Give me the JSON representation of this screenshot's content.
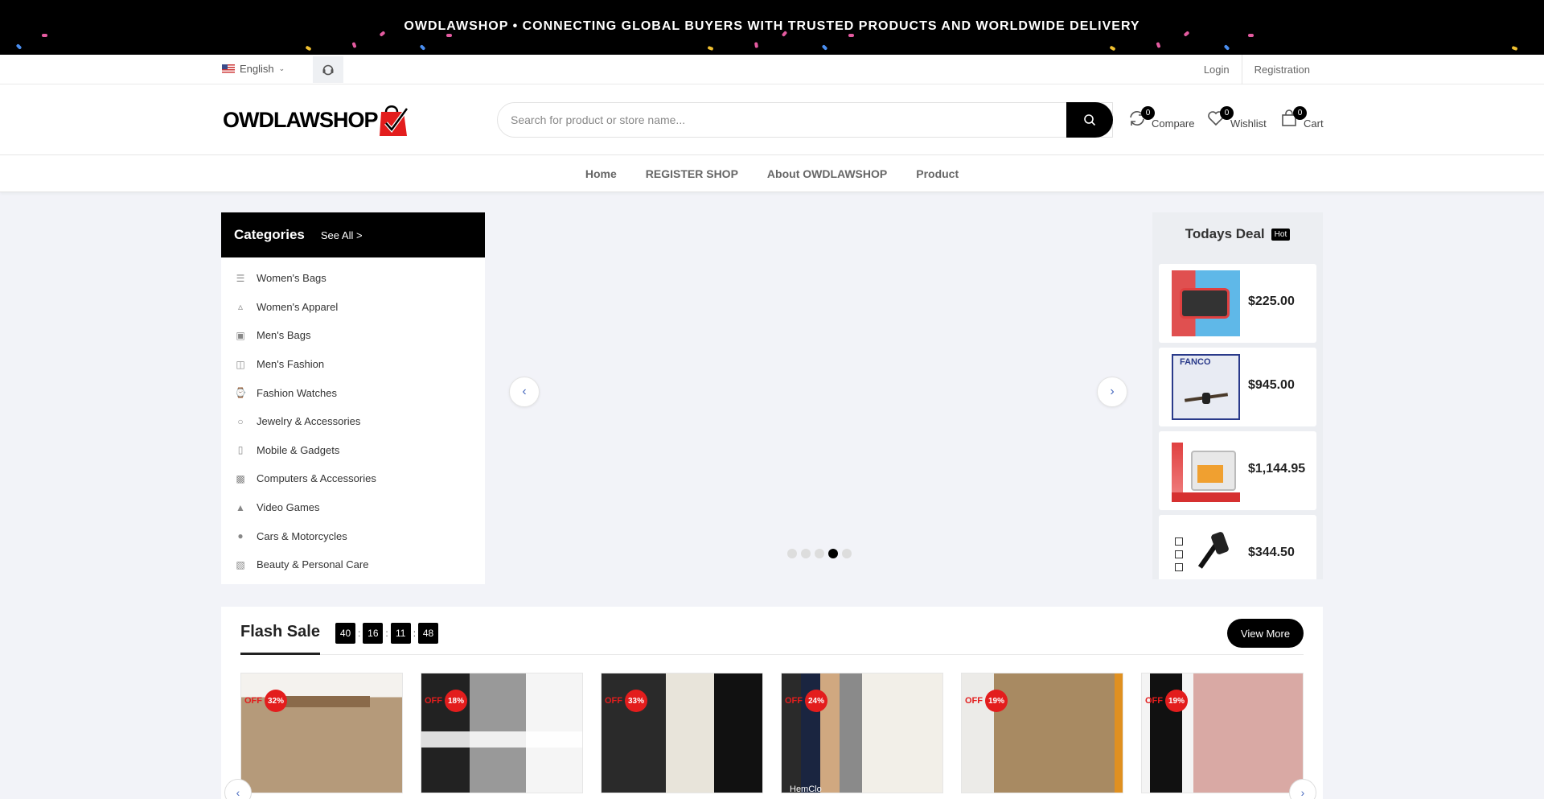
{
  "banner": {
    "text": "OWDLAWSHOP • CONNECTING GLOBAL BUYERS WITH TRUSTED PRODUCTS AND WORLDWIDE DELIVERY"
  },
  "topbar": {
    "language": "English",
    "login": "Login",
    "registration": "Registration"
  },
  "header": {
    "logo_text": "OWDLAWSHOP",
    "search_placeholder": "Search for product or store name...",
    "compare_label": "Compare",
    "compare_count": "0",
    "wishlist_label": "Wishlist",
    "wishlist_count": "0",
    "cart_label": "Cart",
    "cart_count": "0"
  },
  "nav": {
    "items": [
      "Home",
      "REGISTER SHOP",
      "About OWDLAWSHOP",
      "Product"
    ]
  },
  "categories": {
    "title": "Categories",
    "see_all": "See All >",
    "items": [
      "Women's Bags",
      "Women's Apparel",
      "Men's Bags",
      "Men's Fashion",
      "Fashion Watches",
      "Jewelry & Accessories",
      "Mobile & Gadgets",
      "Computers & Accessories",
      "Video Games",
      "Cars & Motorcycles",
      "Beauty & Personal Care"
    ]
  },
  "slider": {
    "active_dot": 4,
    "dot_count": 5
  },
  "todays_deal": {
    "title": "Todays Deal",
    "badge": "Hot",
    "items": [
      {
        "price": "$225.00"
      },
      {
        "price": "$945.00"
      },
      {
        "price": "$1,144.95"
      },
      {
        "price": "$344.50"
      }
    ]
  },
  "flash_sale": {
    "title": "Flash Sale",
    "timer": [
      "40",
      "16",
      "11",
      "48"
    ],
    "timer_sep": ":",
    "view_more": "View More",
    "off_label": "OFF",
    "products": [
      {
        "discount": "32%"
      },
      {
        "discount": "18%"
      },
      {
        "discount": "33%"
      },
      {
        "discount": "24%",
        "watermark": "HemClo"
      },
      {
        "discount": "19%"
      },
      {
        "discount": "19%"
      }
    ]
  },
  "colors": {
    "primary": "#000000",
    "sale_red": "#e31d1d",
    "page_bg": "#f2f3f8",
    "arrow_blue": "#4a6bbf"
  }
}
